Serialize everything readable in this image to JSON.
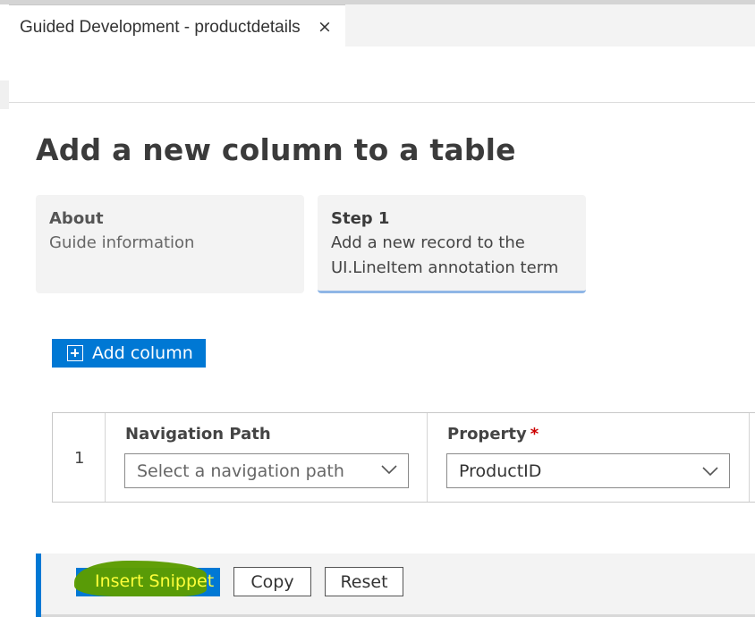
{
  "tab": {
    "title": "Guided Development - productdetails",
    "close_glyph": "×"
  },
  "page": {
    "title": "Add a new column to a table"
  },
  "steps": [
    {
      "title": "About",
      "description_lines": [
        "Guide information"
      ]
    },
    {
      "title": "Step 1",
      "description_lines": [
        "Add a new record to the",
        "UI.LineItem annotation term"
      ],
      "active": true
    }
  ],
  "toolbar": {
    "add_column_label": "Add column",
    "add_column_icon": "plus-square-icon"
  },
  "grid": {
    "rows": [
      {
        "number": "1",
        "navigation_path": {
          "label": "Navigation Path",
          "placeholder": "Select a navigation path",
          "value": ""
        },
        "property": {
          "label": "Property",
          "required_mark": "*",
          "value": "ProductID"
        }
      }
    ]
  },
  "snippet": {
    "insert_label": "Insert Snippet",
    "copy_label": "Copy",
    "reset_label": "Reset"
  },
  "colors": {
    "accent": "#0078d4",
    "highlighter": "#5c9c00",
    "highlight_text": "#ffff3a",
    "required": "#cc0000"
  }
}
